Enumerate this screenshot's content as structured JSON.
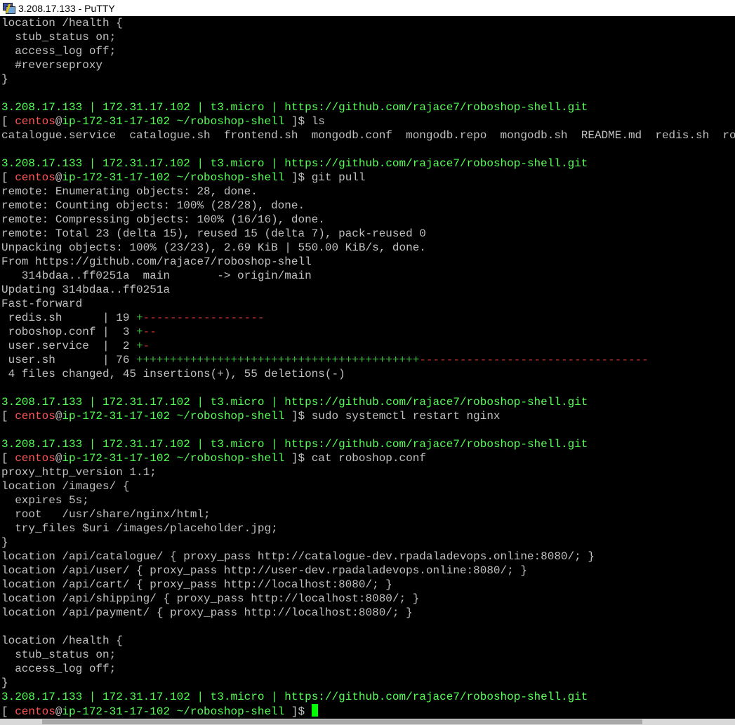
{
  "window": {
    "title": "3.208.17.133 - PuTTY",
    "icon": "putty-icon"
  },
  "colors": {
    "background": "#000000",
    "text": "#c0c0c0",
    "green": "#55ff55",
    "red": "#ff5555",
    "cursor": "#00ff00"
  },
  "terminal": {
    "info": {
      "ip_public": "3.208.17.133",
      "ip_private": "172.31.17.102",
      "instance": "t3.micro",
      "repo": "https://github.com/rajace7/roboshop-shell.git",
      "sep": " | "
    },
    "prompt": {
      "open": "[ ",
      "user": "centos",
      "at": "@",
      "host": "ip-172-31-17-102",
      "path": " ~/roboshop-shell",
      "close": " ]$ "
    },
    "block1": [
      "location /health {",
      "  stub_status on;",
      "  access_log off;",
      "  #reverseproxy",
      "}",
      ""
    ],
    "cmd_ls": "ls",
    "ls_output": "catalogue.service  catalogue.sh  frontend.sh  mongodb.conf  mongodb.repo  mongodb.sh  README.md  redis.sh  roboshop.conf  user.service  user.sh",
    "cmd_git_pull": "git pull",
    "git_output": [
      "remote: Enumerating objects: 28, done.",
      "remote: Counting objects: 100% (28/28), done.",
      "remote: Compressing objects: 100% (16/16), done.",
      "remote: Total 23 (delta 15), reused 15 (delta 7), pack-reused 0",
      "Unpacking objects: 100% (23/23), 2.69 KiB | 550.00 KiB/s, done.",
      "From https://github.com/rajace7/roboshop-shell",
      "   314bdaa..ff0251a  main       -> origin/main",
      "Updating 314bdaa..ff0251a",
      "Fast-forward"
    ],
    "diffstat": [
      {
        "file": " redis.sh      ",
        "count": "| 19 ",
        "plus": "+",
        "minus": "------------------"
      },
      {
        "file": " roboshop.conf ",
        "count": "|  3 ",
        "plus": "+",
        "minus": "--"
      },
      {
        "file": " user.service  ",
        "count": "|  2 ",
        "plus": "+",
        "minus": "-"
      },
      {
        "file": " user.sh       ",
        "count": "| 76 ",
        "plus": "++++++++++++++++++++++++++++++++++++++++++",
        "minus": "----------------------------------"
      }
    ],
    "diff_summary": " 4 files changed, 45 insertions(+), 55 deletions(-)",
    "cmd_restart": "sudo systemctl restart nginx",
    "cmd_cat": "cat roboshop.conf",
    "cat_output": [
      "proxy_http_version 1.1;",
      "location /images/ {",
      "  expires 5s;",
      "  root   /usr/share/nginx/html;",
      "  try_files $uri /images/placeholder.jpg;",
      "}",
      "location /api/catalogue/ { proxy_pass http://catalogue-dev.rpadaladevops.online:8080/; }",
      "location /api/user/ { proxy_pass http://user-dev.rpadaladevops.online:8080/; }",
      "location /api/cart/ { proxy_pass http://localhost:8080/; }",
      "location /api/shipping/ { proxy_pass http://localhost:8080/; }",
      "location /api/payment/ { proxy_pass http://localhost:8080/; }",
      "",
      "location /health {",
      "  stub_status on;",
      "  access_log off;",
      "}"
    ]
  }
}
